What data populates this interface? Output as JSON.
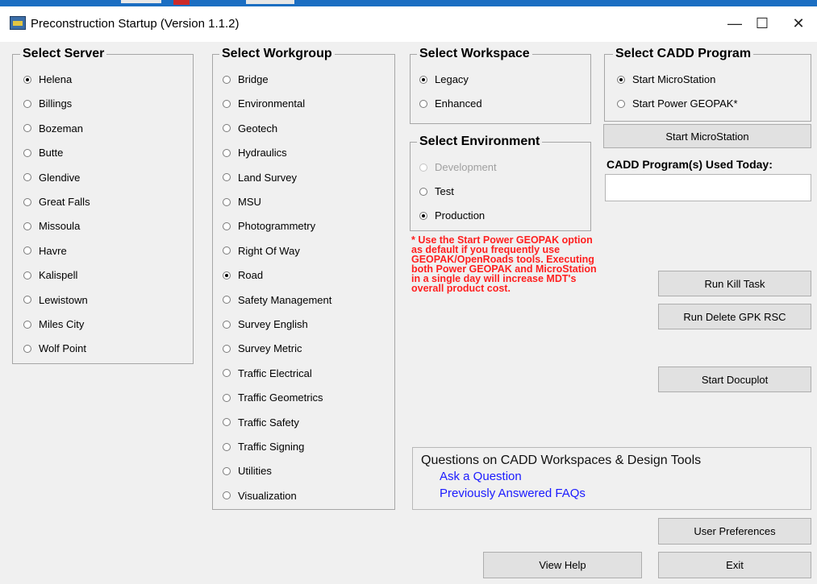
{
  "window": {
    "title": "Preconstruction Startup (Version 1.1.2)",
    "controls": {
      "minimize": "—",
      "maximize": "☐",
      "close": "✕"
    }
  },
  "server": {
    "legend": "Select Server",
    "options": [
      "Helena",
      "Billings",
      "Bozeman",
      "Butte",
      "Glendive",
      "Great Falls",
      "Missoula",
      "Havre",
      "Kalispell",
      "Lewistown",
      "Miles City",
      "Wolf Point"
    ],
    "selected": "Helena"
  },
  "workgroup": {
    "legend": "Select Workgroup",
    "options": [
      "Bridge",
      "Environmental",
      "Geotech",
      "Hydraulics",
      "Land Survey",
      "MSU",
      "Photogrammetry",
      "Right Of Way",
      "Road",
      "Safety Management",
      "Survey English",
      "Survey Metric",
      "Traffic Electrical",
      "Traffic Geometrics",
      "Traffic Safety",
      "Traffic Signing",
      "Utilities",
      "Visualization"
    ],
    "selected": "Road"
  },
  "workspace": {
    "legend": "Select Workspace",
    "options": [
      "Legacy",
      "Enhanced"
    ],
    "selected": "Legacy"
  },
  "environment": {
    "legend": "Select Environment",
    "options": [
      "Development",
      "Test",
      "Production"
    ],
    "selected": "Production",
    "disabled": [
      "Development"
    ]
  },
  "cadd": {
    "legend": "Select CADD Program",
    "options": [
      "Start MicroStation",
      "Start Power GEOPAK*"
    ],
    "selected": "Start MicroStation",
    "start_button": "Start MicroStation",
    "used_today_label": "CADD Program(s) Used Today:",
    "used_today_value": ""
  },
  "note": {
    "text": "* Use the Start Power GEOPAK option as default if you frequently use GEOPAK/OpenRoads tools. Executing both Power GEOPAK and MicroStation in a single day will increase MDT's overall product cost.",
    "color": "#ff2020"
  },
  "buttons": {
    "kill_task": "Run Kill Task",
    "delete_gpk": "Run Delete GPK RSC",
    "docuplot": "Start Docuplot",
    "user_prefs": "User Preferences",
    "view_help": "View Help",
    "exit": "Exit"
  },
  "questions": {
    "title": "Questions on CADD Workspaces & Design Tools",
    "links": [
      "Ask a Question",
      "Previously Answered FAQs"
    ]
  },
  "colors": {
    "background": "#f0f0f0",
    "link": "#1a1aff",
    "accent_bar": "#1b6ec2"
  }
}
